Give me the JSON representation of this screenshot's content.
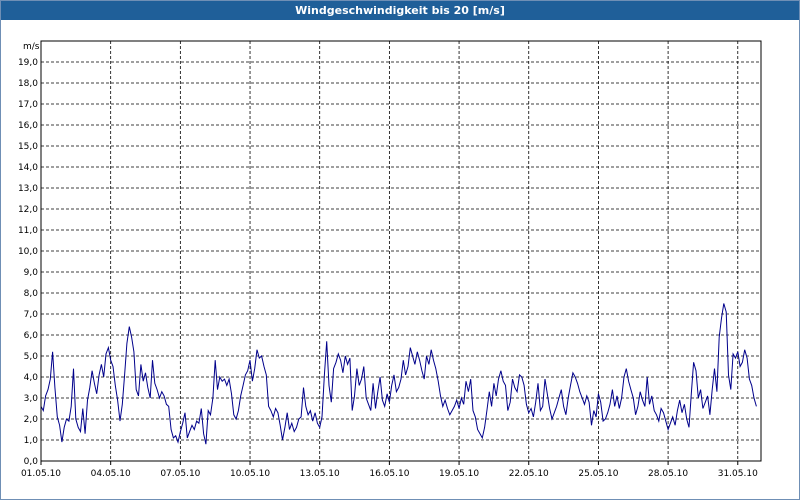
{
  "window": {
    "title": "Windgeschwindigkeit bis 20 [m/s]"
  },
  "chart_data": {
    "type": "line",
    "title": "Windgeschwindigkeit bis 20 [m/s]",
    "ylabel": "m/s",
    "xlabel": "",
    "ylim": [
      0,
      20
    ],
    "yticks": [
      "0,0",
      "1,0",
      "2,0",
      "3,0",
      "4,0",
      "5,0",
      "6,0",
      "7,0",
      "8,0",
      "9,0",
      "10,0",
      "11,0",
      "12,0",
      "13,0",
      "14,0",
      "15,0",
      "16,0",
      "17,0",
      "18,0",
      "19,0"
    ],
    "xticks": [
      "01.05.10",
      "04.05.10",
      "07.05.10",
      "10.05.10",
      "13.05.10",
      "16.05.10",
      "19.05.10",
      "22.05.10",
      "25.05.10",
      "28.05.10",
      "31.05.10"
    ],
    "x_start": "01.05.10",
    "x_end": "01.06.10",
    "grid": true,
    "line_color": "#00008b",
    "series": [
      {
        "x_days": [
          0,
          0.1,
          0.2,
          0.3,
          0.4,
          0.5,
          0.6,
          0.7,
          0.8,
          0.9,
          1.0,
          1.1,
          1.2,
          1.3,
          1.4,
          1.5,
          1.6,
          1.7,
          1.8,
          1.9,
          2.0,
          2.1,
          2.2,
          2.3,
          2.4,
          2.5,
          2.6,
          2.7,
          2.8,
          2.9,
          3.0,
          3.1,
          3.2,
          3.3,
          3.4,
          3.5,
          3.6,
          3.7,
          3.8,
          3.9,
          4.0,
          4.1,
          4.2,
          4.3,
          4.4,
          4.5,
          4.6,
          4.7,
          4.8,
          4.9,
          5.0,
          5.1,
          5.2,
          5.3,
          5.4,
          5.5,
          5.6,
          5.7,
          5.8,
          5.9,
          6.0,
          6.1,
          6.2,
          6.3,
          6.4,
          6.5,
          6.6,
          6.7,
          6.8,
          6.9,
          7.0,
          7.1,
          7.2,
          7.3,
          7.4,
          7.5,
          7.6,
          7.7,
          7.8,
          7.9,
          8.0,
          8.1,
          8.2,
          8.3,
          8.4,
          8.5,
          8.6,
          8.7,
          8.8,
          8.9,
          9.0,
          9.1,
          9.2,
          9.3,
          9.4,
          9.5,
          9.6,
          9.7,
          9.8,
          9.9,
          10.0,
          10.1,
          10.2,
          10.3,
          10.4,
          10.5,
          10.6,
          10.7,
          10.8,
          10.9,
          11.0,
          11.1,
          11.2,
          11.3,
          11.4,
          11.5,
          11.6,
          11.7,
          11.8,
          11.9,
          12.0,
          12.1,
          12.2,
          12.3,
          12.4,
          12.5,
          12.6,
          12.7,
          12.8,
          12.9,
          13.0,
          13.1,
          13.2,
          13.3,
          13.4,
          13.5,
          13.6,
          13.7,
          13.8,
          13.9,
          14.0,
          14.1,
          14.2,
          14.3,
          14.4,
          14.5,
          14.6,
          14.7,
          14.8,
          14.9,
          15.0,
          15.1,
          15.2,
          15.3,
          15.4,
          15.5,
          15.6,
          15.7,
          15.8,
          15.9,
          16.0,
          16.1,
          16.2,
          16.3,
          16.4,
          16.5,
          16.6,
          16.7,
          16.8,
          16.9,
          17.0,
          17.1,
          17.2,
          17.3,
          17.4,
          17.5,
          17.6,
          17.7,
          17.8,
          17.9,
          18.0,
          18.1,
          18.2,
          18.3,
          18.4,
          18.5,
          18.6,
          18.7,
          18.8,
          18.9,
          19.0,
          19.1,
          19.2,
          19.3,
          19.4,
          19.5,
          19.6,
          19.7,
          19.8,
          19.9,
          20.0,
          20.1,
          20.2,
          20.3,
          20.4,
          20.5,
          20.6,
          20.7,
          20.8,
          20.9,
          21.0,
          21.1,
          21.2,
          21.3,
          21.4,
          21.5,
          21.6,
          21.7,
          21.8,
          21.9,
          22.0,
          22.1,
          22.2,
          22.3,
          22.4,
          22.5,
          22.6,
          22.7,
          22.8,
          22.9,
          23.0,
          23.1,
          23.2,
          23.3,
          23.4,
          23.5,
          23.6,
          23.7,
          23.8,
          23.9,
          24.0,
          24.1,
          24.2,
          24.3,
          24.4,
          24.5,
          24.6,
          24.7,
          24.8,
          24.9,
          25.0,
          25.1,
          25.2,
          25.3,
          25.4,
          25.5,
          25.6,
          25.7,
          25.8,
          25.9,
          26.0,
          26.1,
          26.2,
          26.3,
          26.4,
          26.5,
          26.6,
          26.7,
          26.8,
          26.9,
          27.0,
          27.1,
          27.2,
          27.3,
          27.4,
          27.5,
          27.6,
          27.7,
          27.8,
          27.9,
          28.0,
          28.1,
          28.2,
          28.3,
          28.4,
          28.5,
          28.6,
          28.7,
          28.8,
          28.9,
          29.0,
          29.1,
          29.2,
          29.3,
          29.4,
          29.5,
          29.6,
          29.7,
          29.8,
          29.9,
          30.0,
          30.1,
          30.2,
          30.3,
          30.4,
          30.5,
          30.6,
          30.7,
          30.8,
          30.9,
          31.0
        ],
        "values": [
          2.6,
          2.4,
          3.1,
          3.4,
          3.9,
          5.2,
          3.5,
          2.1,
          1.7,
          0.9,
          1.6,
          2.0,
          1.9,
          2.6,
          4.4,
          2.0,
          1.6,
          1.4,
          2.5,
          1.3,
          2.9,
          3.5,
          4.3,
          3.7,
          3.2,
          4.1,
          4.6,
          4.0,
          5.1,
          5.4,
          4.8,
          4.5,
          3.6,
          2.9,
          1.9,
          2.7,
          4.1,
          5.6,
          6.4,
          5.9,
          5.2,
          3.4,
          3.1,
          4.6,
          3.8,
          4.2,
          3.5,
          3.0,
          4.8,
          3.7,
          3.4,
          3.0,
          3.3,
          3.1,
          2.7,
          2.6,
          1.5,
          1.1,
          1.2,
          0.9,
          1.4,
          1.8,
          2.3,
          1.1,
          1.4,
          1.7,
          1.5,
          1.9,
          1.8,
          2.5,
          1.3,
          0.8,
          2.4,
          2.2,
          3.0,
          4.8,
          3.4,
          4.0,
          3.8,
          3.9,
          3.6,
          3.9,
          3.2,
          2.2,
          2.0,
          2.4,
          3.1,
          3.6,
          4.1,
          4.3,
          4.8,
          3.8,
          4.4,
          5.3,
          4.9,
          5.0,
          4.5,
          4.1,
          2.6,
          2.4,
          2.1,
          2.5,
          2.3,
          1.7,
          1.0,
          1.6,
          2.3,
          1.5,
          1.8,
          1.4,
          1.6,
          2.0,
          2.1,
          3.5,
          2.6,
          2.2,
          2.4,
          1.9,
          2.3,
          1.8,
          1.6,
          2.1,
          4.1,
          5.7,
          3.6,
          2.8,
          4.4,
          4.7,
          5.1,
          4.8,
          4.2,
          5.0,
          4.6,
          4.9,
          2.4,
          3.1,
          4.4,
          3.6,
          3.9,
          4.5,
          3.0,
          2.7,
          2.4,
          3.7,
          2.5,
          3.3,
          4.0,
          2.9,
          2.6,
          3.2,
          2.8,
          3.6,
          4.1,
          3.3,
          3.5,
          3.9,
          4.8,
          4.1,
          4.5,
          5.4,
          5.0,
          4.6,
          5.2,
          4.8,
          4.3,
          3.9,
          5.0,
          4.6,
          5.3,
          4.8,
          4.4,
          3.8,
          3.1,
          2.6,
          2.9,
          2.5,
          2.2,
          2.4,
          2.6,
          2.9,
          2.5,
          3.0,
          2.7,
          3.8,
          3.3,
          3.9,
          2.4,
          2.1,
          1.5,
          1.3,
          1.1,
          1.6,
          2.4,
          3.3,
          2.6,
          3.7,
          3.1,
          3.9,
          4.3,
          3.8,
          3.6,
          2.4,
          2.8,
          3.9,
          3.5,
          3.3,
          4.1,
          4.0,
          3.6,
          2.7,
          2.3,
          2.5,
          2.1,
          2.8,
          3.7,
          2.4,
          2.6,
          3.9,
          3.2,
          2.5,
          2.0,
          2.3,
          2.6,
          3.0,
          3.4,
          2.6,
          2.2,
          3.0,
          3.6,
          4.2,
          4.0,
          3.7,
          3.3,
          3.0,
          2.7,
          3.1,
          2.8,
          1.7,
          2.4,
          2.1,
          3.2,
          2.8,
          1.9,
          2.0,
          2.3,
          2.7,
          3.4,
          2.6,
          3.1,
          2.5,
          3.0,
          4.0,
          4.4,
          3.8,
          3.4,
          3.0,
          2.2,
          2.6,
          3.3,
          2.9,
          2.6,
          4.0,
          2.7,
          3.1,
          2.4,
          2.2,
          1.9,
          2.5,
          2.3,
          1.9,
          1.5,
          1.8,
          2.1,
          1.7,
          2.4,
          2.9,
          2.3,
          2.7,
          2.0,
          1.6,
          3.2,
          4.7,
          4.3,
          3.0,
          3.4,
          2.5,
          2.8,
          3.1,
          2.2,
          3.4,
          4.4,
          3.3,
          5.9,
          6.8,
          7.5,
          7.1,
          4.1,
          3.4,
          5.1,
          4.9,
          5.2,
          4.5,
          4.7,
          5.3,
          4.9,
          3.9,
          3.6,
          3.0,
          2.6
        ]
      }
    ]
  }
}
